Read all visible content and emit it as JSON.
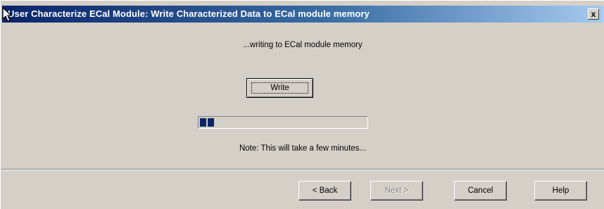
{
  "window": {
    "title": "User Characterize ECal Module: Write Characterized Data to ECal module memory",
    "close_label": "x"
  },
  "main": {
    "status_text": "...writing to ECal module memory",
    "write_button_label": "Write",
    "progress_fraction": 0.08,
    "note_text": "Note:  This will take a few minutes..."
  },
  "footer": {
    "back_label": "< Back",
    "next_label": "Next >",
    "cancel_label": "Cancel",
    "help_label": "Help"
  },
  "colors": {
    "title_start": "#0a246a",
    "title_end": "#a6caf0",
    "progress_fill": "#0a246a",
    "dialog_bg": "#d4d0c8"
  }
}
